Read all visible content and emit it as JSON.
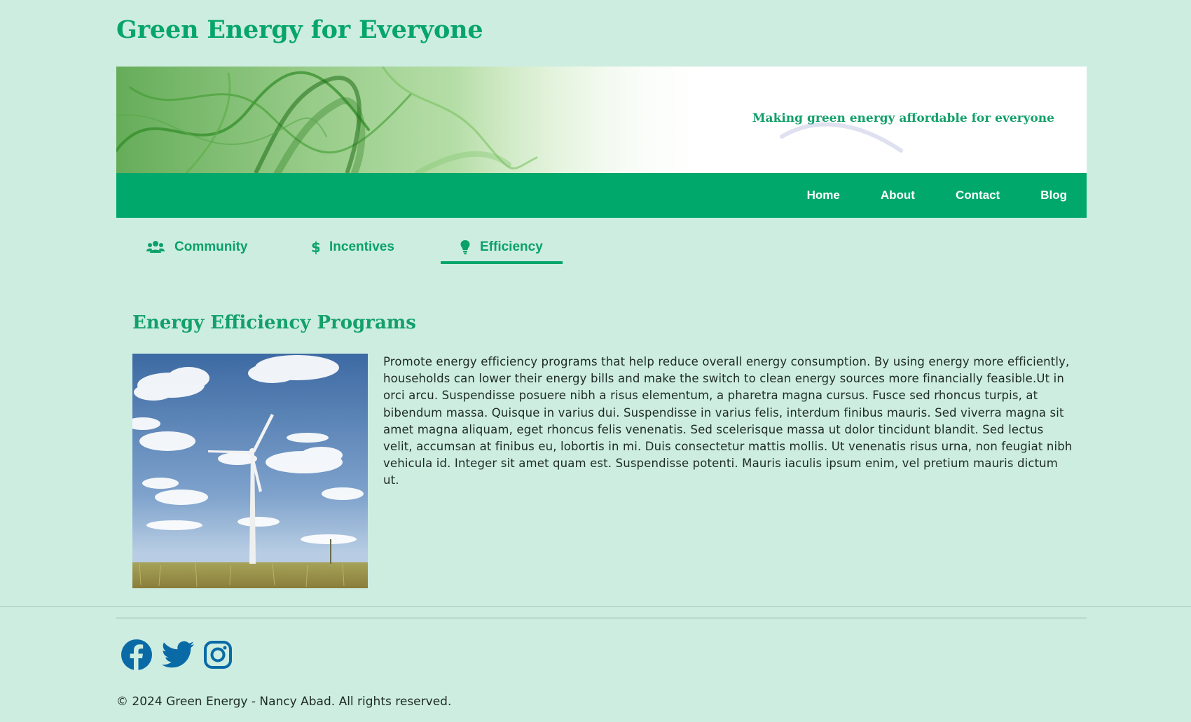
{
  "header": {
    "site_title": "Green Energy for Everyone",
    "tagline": "Making green energy affordable for everyone"
  },
  "nav": {
    "items": [
      {
        "label": "Home"
      },
      {
        "label": "About"
      },
      {
        "label": "Contact"
      },
      {
        "label": "Blog"
      }
    ]
  },
  "tabs": [
    {
      "label": "Community",
      "icon": "users-icon",
      "active": false
    },
    {
      "label": "Incentives",
      "icon": "dollar-icon",
      "active": false
    },
    {
      "label": "Efficiency",
      "icon": "lightbulb-icon",
      "active": true
    }
  ],
  "main": {
    "section_title": "Energy Efficiency Programs",
    "image_subject": "wind-turbine-photo",
    "body": "Promote energy efficiency programs that help reduce overall energy consumption. By using energy more efficiently, households can lower their energy bills and make the switch to clean energy sources more financially feasible.Ut in orci arcu. Suspendisse posuere nibh a risus elementum, a pharetra magna cursus. Fusce sed rhoncus turpis, at bibendum massa. Quisque in varius dui. Suspendisse in varius felis, interdum finibus mauris. Sed viverra magna sit amet magna aliquam, eget rhoncus felis venenatis. Sed scelerisque massa ut dolor tincidunt blandit. Sed lectus velit, accumsan at finibus eu, lobortis in mi. Duis consectetur mattis mollis. Ut venenatis risus urna, non feugiat nibh vehicula id. Integer sit amet quam est. Suspendisse potenti. Mauris iaculis ipsum enim, vel pretium mauris dictum ut."
  },
  "footer": {
    "social": [
      "facebook-icon",
      "twitter-icon",
      "instagram-icon"
    ],
    "copyright": "© 2024 Green Energy - Nancy Abad. All rights reserved."
  },
  "colors": {
    "background": "#cdede1",
    "brand_green": "#00a86b",
    "social_blue": "#0a6aa6"
  }
}
